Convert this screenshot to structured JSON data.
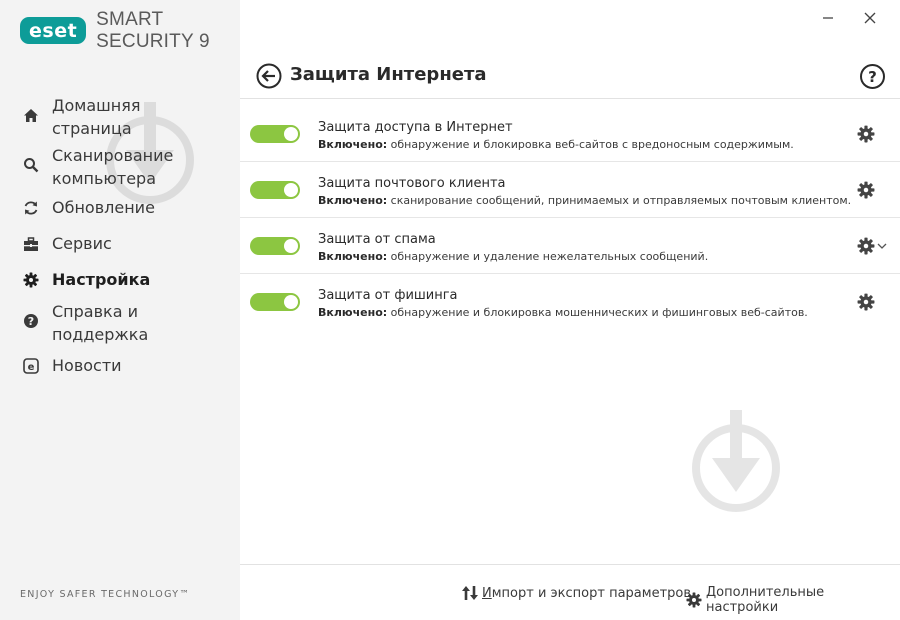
{
  "app": {
    "logo_text": "eset",
    "product_name": "SMART SECURITY 9",
    "tagline": "ENJOY SAFER TECHNOLOGY™"
  },
  "window": {
    "minimize_glyph": "–",
    "close_glyph": "✕"
  },
  "sidebar": {
    "items": [
      {
        "label": "Домашняя\nстраница",
        "icon": "home-icon"
      },
      {
        "label": "Сканирование\nкомпьютера",
        "icon": "search-icon"
      },
      {
        "label": "Обновление",
        "icon": "refresh-icon"
      },
      {
        "label": "Сервис",
        "icon": "toolbox-icon"
      },
      {
        "label": "Настройка",
        "icon": "gear-icon",
        "active": true
      },
      {
        "label": "Справка и\nподдержка",
        "icon": "help-icon"
      },
      {
        "label": "Новости",
        "icon": "news-icon"
      }
    ]
  },
  "header": {
    "title": "Защита Интернета",
    "help_glyph": "?"
  },
  "rows": [
    {
      "title": "Защита доступа в Интернет",
      "status": "Включено:",
      "desc": "обнаружение и блокировка веб-сайтов с вредоносным содержимым.",
      "enabled": true
    },
    {
      "title": "Защита почтового клиента",
      "status": "Включено:",
      "desc": "сканирование сообщений, принимаемых и отправляемых почтовым клиентом.",
      "enabled": true
    },
    {
      "title": "Защита от спама",
      "status": "Включено:",
      "desc": "обнаружение и удаление нежелательных сообщений.",
      "enabled": true,
      "has_dropdown": true
    },
    {
      "title": "Защита от фишинга",
      "status": "Включено:",
      "desc": "обнаружение и блокировка мошеннических и фишинговых веб-сайтов.",
      "enabled": true
    }
  ],
  "footer": {
    "import_export_underlined": "И",
    "import_export_rest": "мпорт и экспорт параметров",
    "advanced_underlined": "Д",
    "advanced_rest": "ополнительные настройки"
  },
  "colors": {
    "brand": "#0d9c98",
    "toggle_on": "#8cc641",
    "sidebar_bg": "#f3f3f3"
  }
}
